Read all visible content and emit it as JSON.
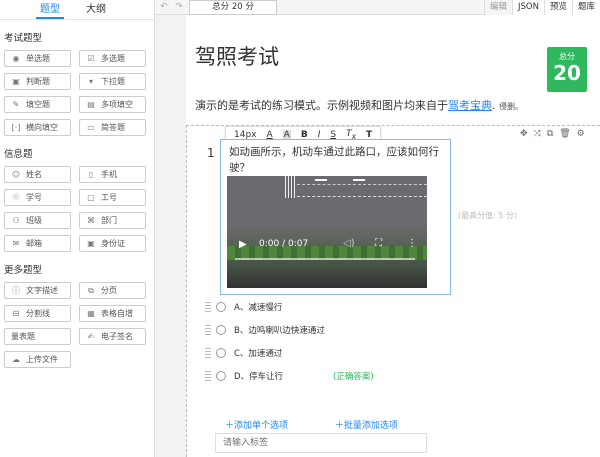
{
  "sidebar": {
    "tabs": [
      "题型",
      "大纲"
    ],
    "groups": [
      {
        "title": "考试题型",
        "items": [
          {
            "label": "单选题",
            "icon": "radio-icon"
          },
          {
            "label": "多选题",
            "icon": "checkbox-icon"
          },
          {
            "label": "判断题",
            "icon": "judge-icon"
          },
          {
            "label": "下拉题",
            "icon": "dropdown-icon"
          },
          {
            "label": "填空题",
            "icon": "edit-icon"
          },
          {
            "label": "多项填空",
            "icon": "multi-fill-icon"
          },
          {
            "label": "横向填空",
            "icon": "bracket-icon"
          },
          {
            "label": "简答题",
            "icon": "textarea-icon"
          }
        ]
      },
      {
        "title": "信息题",
        "items": [
          {
            "label": "姓名",
            "icon": "person-icon"
          },
          {
            "label": "手机",
            "icon": "phone-icon"
          },
          {
            "label": "学号",
            "icon": "id-number-icon"
          },
          {
            "label": "工号",
            "icon": "id-card-icon"
          },
          {
            "label": "班级",
            "icon": "group-icon"
          },
          {
            "label": "部门",
            "icon": "org-icon"
          },
          {
            "label": "邮箱",
            "icon": "mail-icon"
          },
          {
            "label": "身份证",
            "icon": "id-card-icon"
          }
        ]
      },
      {
        "title": "更多题型",
        "items": [
          {
            "label": "文字描述",
            "icon": "info-icon"
          },
          {
            "label": "分页",
            "icon": "page-icon"
          },
          {
            "label": "分割线",
            "icon": "divider-icon"
          },
          {
            "label": "表格自增",
            "icon": "table-icon"
          },
          {
            "label": "量表题",
            "icon": ""
          },
          {
            "label": "电子签名",
            "icon": "signature-icon"
          },
          {
            "label": "上传文件",
            "icon": "upload-icon"
          }
        ]
      }
    ]
  },
  "topbar": {
    "score": "总分 20 分",
    "buttons": [
      "编辑",
      "JSON",
      "预览",
      "题库"
    ]
  },
  "exam": {
    "title": "驾照考试",
    "score_label": "总分",
    "score_value": "20",
    "desc_prefix": "演示的是考试的练习模式。示例视频和图片均来自于",
    "desc_link": "驾考宝典",
    "desc_suffix": "侵删。"
  },
  "toolbar": {
    "font_size": "14px"
  },
  "question": {
    "number": "1",
    "text": "如动画所示，机动车通过此路口，应该如何行驶？",
    "video_time": "0:00 / 0:07",
    "max_score": "(最高分值: 5 分)",
    "options": [
      {
        "label": "A、减速慢行"
      },
      {
        "label": "B、边鸣喇叭边快速通过"
      },
      {
        "label": "C、加速通过"
      },
      {
        "label": "D、停车让行",
        "tag": "(正确答案)"
      }
    ],
    "add_single": "添加单个选项",
    "add_batch": "批量添加选项",
    "tag_placeholder": "请输入标签"
  },
  "colors": {
    "accent": "#1e87f0",
    "score_bg": "#2fb85e"
  }
}
